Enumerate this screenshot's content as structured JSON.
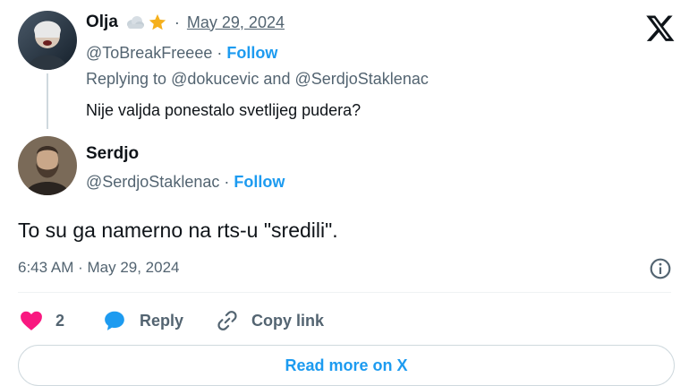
{
  "reply_tweet": {
    "name": "Olja",
    "badges": [
      "cloud-icon",
      "star-icon"
    ],
    "date": "May 29, 2024",
    "handle": "@ToBreakFreeee",
    "follow_label": "Follow",
    "replying_prefix": "Replying to",
    "replying_to_1": "@dokucevic",
    "replying_and": "and",
    "replying_to_2": "@SerdjoStaklenac",
    "text": "Nije valjda ponestalo svetlijeg pudera?"
  },
  "main_tweet": {
    "name": "Serdjo",
    "handle": "@SerdjoStaklenac",
    "follow_label": "Follow",
    "text": "To su ga namerno na rts-u \"sredili\".",
    "timestamp": "6:43 AM · May 29, 2024"
  },
  "actions": {
    "like_count": "2",
    "reply_label": "Reply",
    "copy_link_label": "Copy link"
  },
  "read_more_label": "Read more on X",
  "colors": {
    "accent": "#1d9bf0",
    "like": "#f91880",
    "text": "#0f1419",
    "muted": "#536471"
  }
}
